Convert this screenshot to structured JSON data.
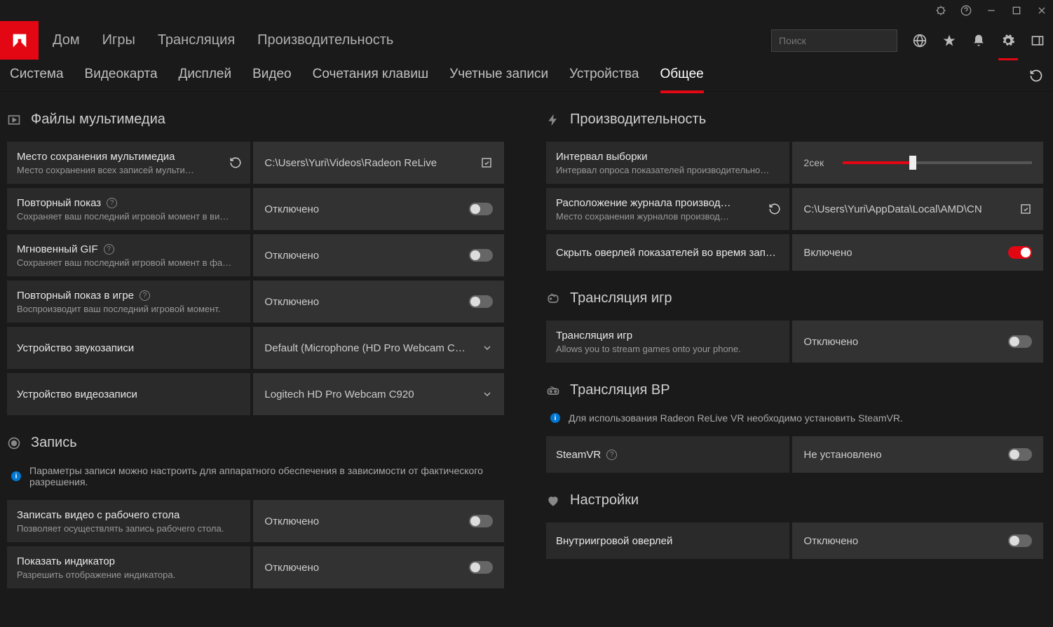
{
  "titlebar": {},
  "nav": {
    "home": "Дом",
    "games": "Игры",
    "stream": "Трансляция",
    "perf": "Производительность"
  },
  "search": {
    "placeholder": "Поиск"
  },
  "tabs": {
    "system": "Система",
    "gpu": "Видеокарта",
    "display": "Дисплей",
    "video": "Видео",
    "hotkeys": "Сочетания клавиш",
    "accounts": "Учетные записи",
    "devices": "Устройства",
    "general": "Общее"
  },
  "sections": {
    "media": "Файлы мультимедиа",
    "record": "Запись",
    "perf": "Производительность",
    "gamestream": "Трансляция игр",
    "vrstream": "Трансляция ВР",
    "prefs": "Настройки"
  },
  "info": {
    "record": "Параметры записи можно настроить для аппаратного обеспечения в зависимости от фактического разрешения.",
    "vr": "Для использования Radeon ReLive VR необходимо установить SteamVR."
  },
  "vals": {
    "off": "Отключено",
    "on": "Включено",
    "notinstalled": "Не установлено"
  },
  "settings": {
    "mediapath": {
      "title": "Место сохранения мультимедиа",
      "desc": "Место сохранения всех записей мульти…",
      "value": "C:\\Users\\Yuri\\Videos\\Radeon ReLive"
    },
    "replay": {
      "title": "Повторный показ",
      "desc": "Сохраняет ваш последний игровой момент в ви…"
    },
    "instantgif": {
      "title": "Мгновенный GIF",
      "desc": "Сохраняет ваш последний игровой момент в фа…"
    },
    "ingamereplay": {
      "title": "Повторный показ в игре",
      "desc": "Воспроизводит ваш последний игровой момент."
    },
    "audiodev": {
      "title": "Устройство звукозаписи",
      "value": "Default (Microphone (HD Pro Webcam C…"
    },
    "videodev": {
      "title": "Устройство видеозаписи",
      "value": "Logitech HD Pro Webcam C920"
    },
    "desktoprec": {
      "title": "Записать видео с рабочего стола",
      "desc": "Позволяет осуществлять запись рабочего стола."
    },
    "indicator": {
      "title": "Показать индикатор",
      "desc": "Разрешить отображение индикатора."
    },
    "sampling": {
      "title": "Интервал выборки",
      "desc": "Интервал опроса показателей производительно…",
      "value": "2сек"
    },
    "perflog": {
      "title": "Расположение журнала производ…",
      "desc": "Место сохранения журналов производ…",
      "value": "C:\\Users\\Yuri\\AppData\\Local\\AMD\\CN"
    },
    "hideoverlay": {
      "title": "Скрыть оверлей показателей во время зап…"
    },
    "gamestream": {
      "title": "Трансляция игр",
      "desc": "Allows you to stream games onto your phone."
    },
    "steamvr": {
      "title": "SteamVR"
    },
    "ingameoverlay": {
      "title": "Внутриигровой оверлей"
    }
  }
}
